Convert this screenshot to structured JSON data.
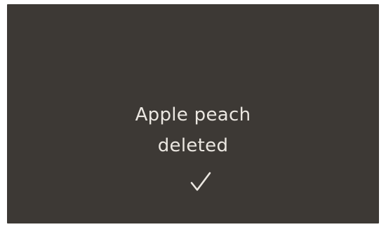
{
  "notification": {
    "line1": "Apple peach",
    "line2": "deleted",
    "icon": "checkmark-icon"
  }
}
